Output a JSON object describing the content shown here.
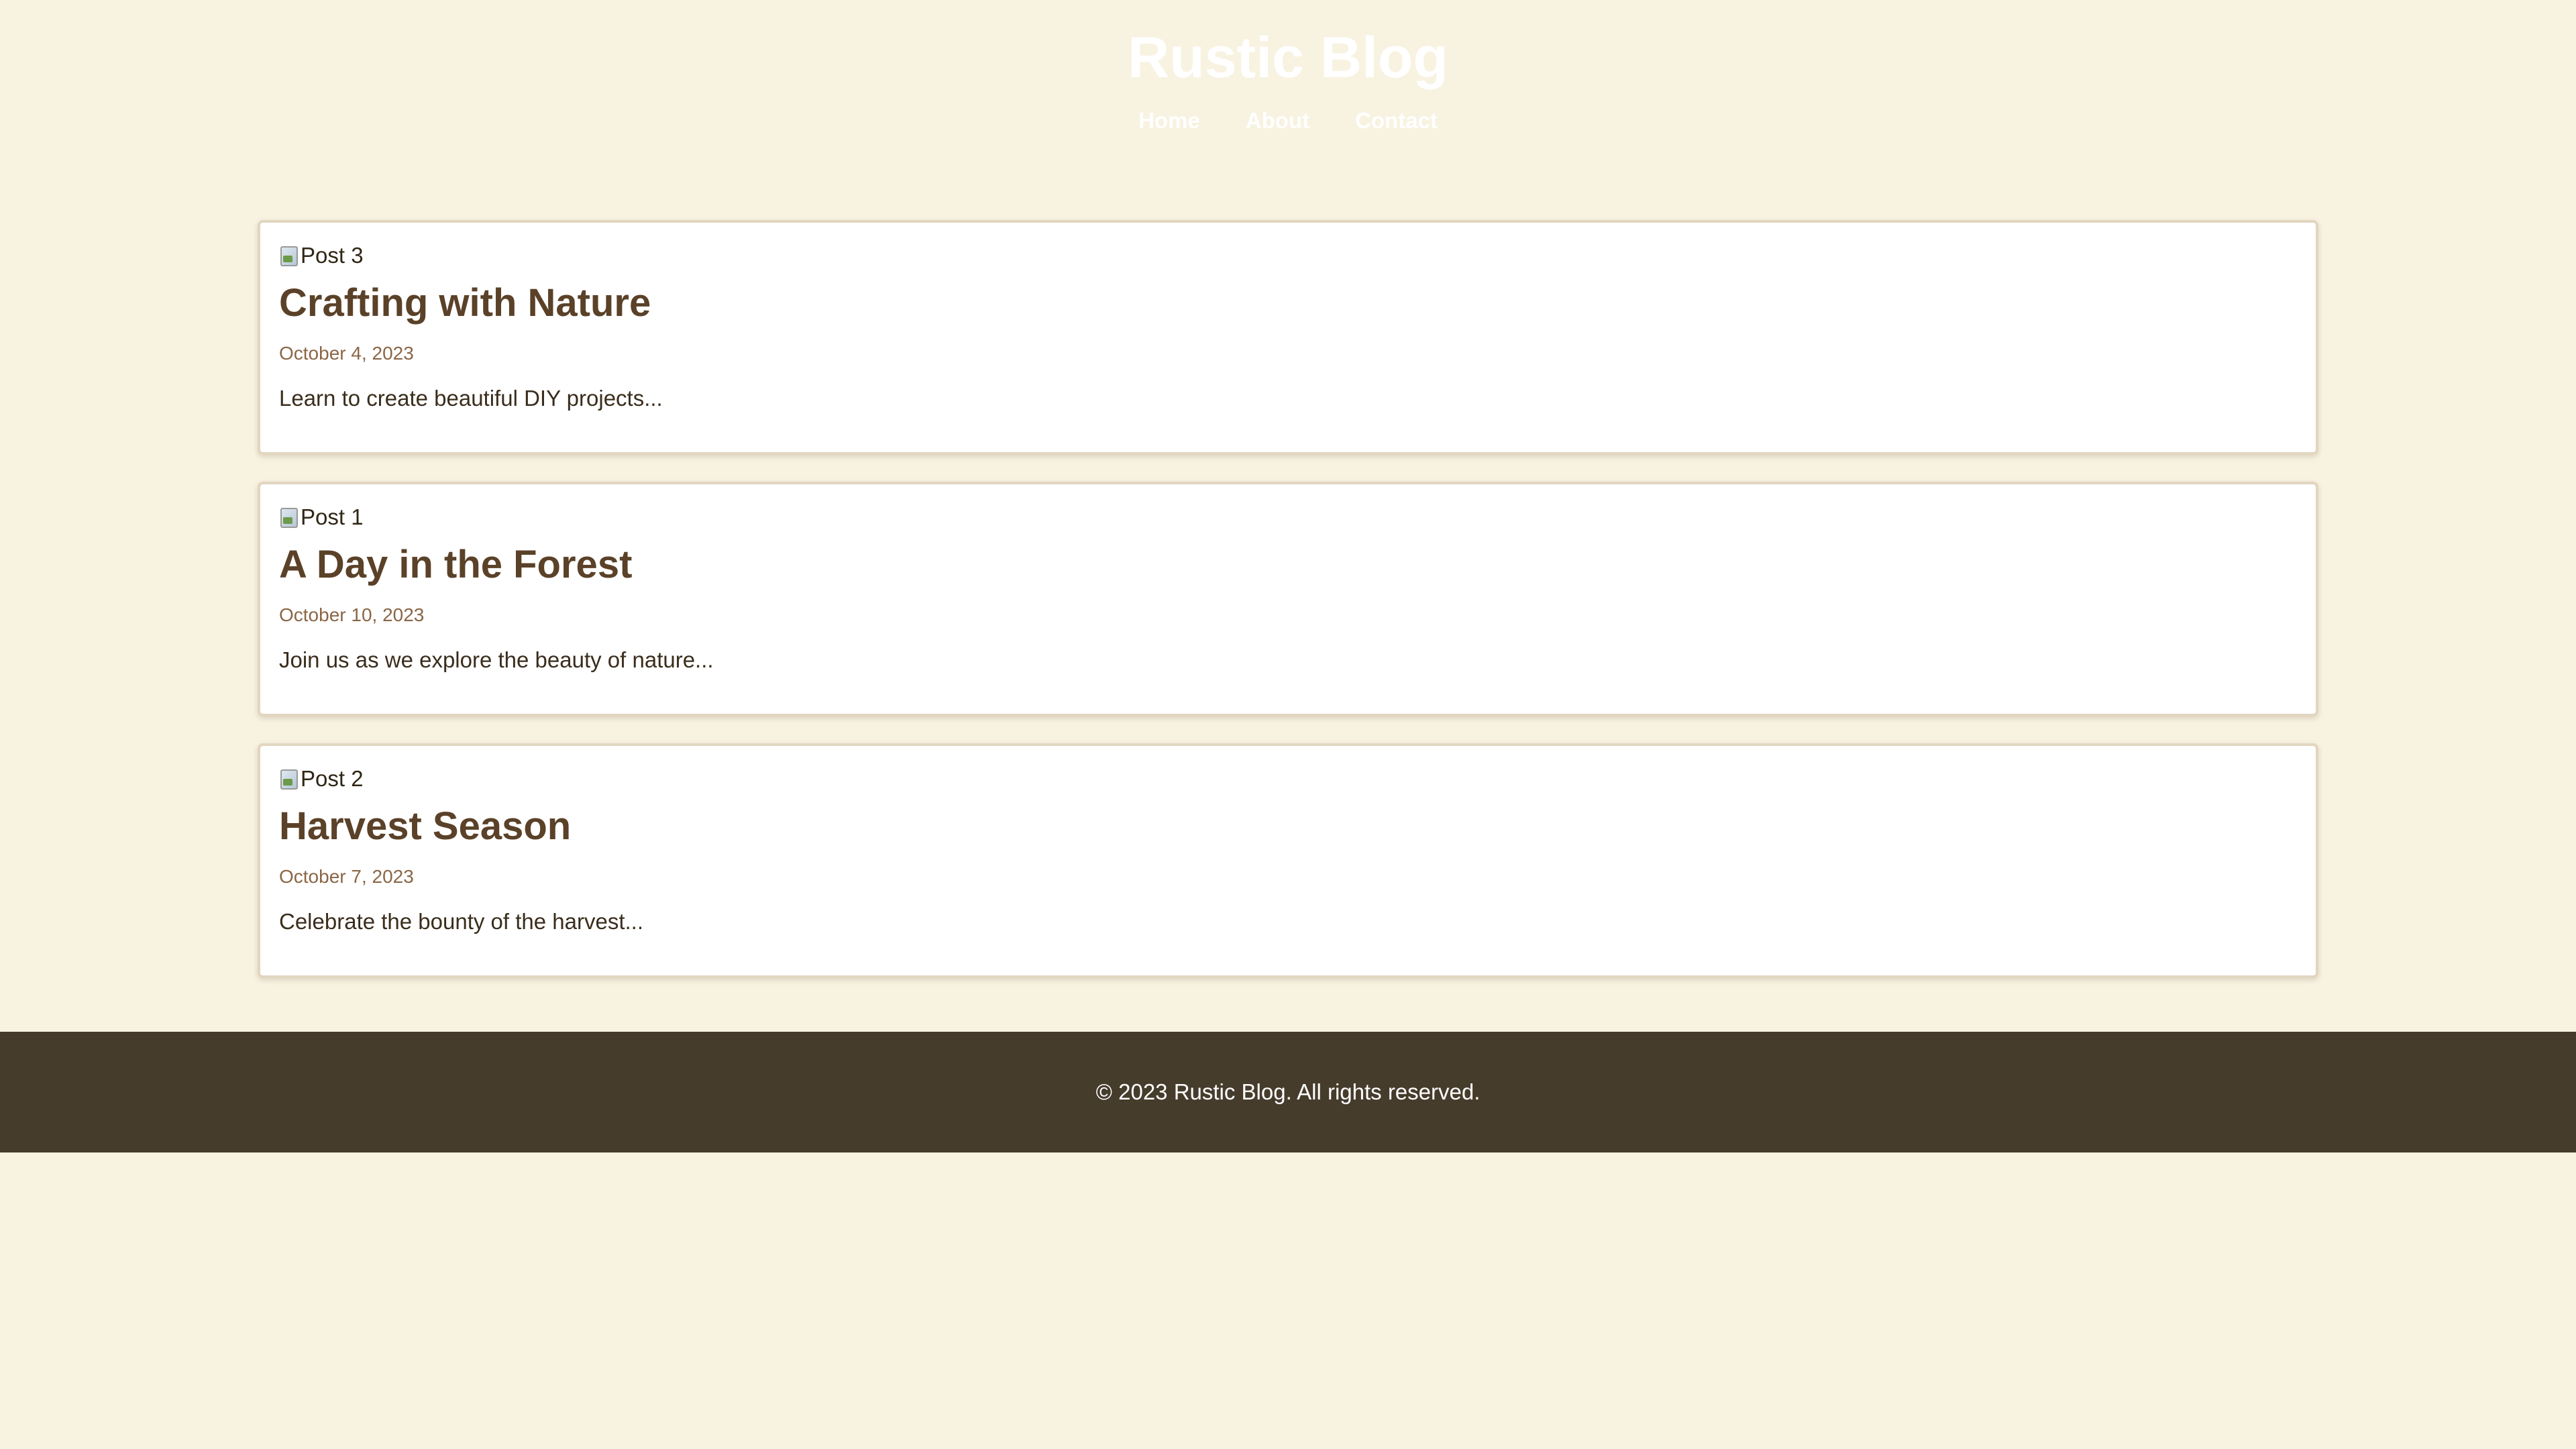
{
  "header": {
    "title": "Rustic Blog",
    "nav": [
      {
        "label": "Home"
      },
      {
        "label": "About"
      },
      {
        "label": "Contact"
      }
    ]
  },
  "posts": [
    {
      "image_alt": "Post 3",
      "title": "Crafting with Nature",
      "date": "October 4, 2023",
      "excerpt": "Learn to create beautiful DIY projects..."
    },
    {
      "image_alt": "Post 1",
      "title": "A Day in the Forest",
      "date": "October 10, 2023",
      "excerpt": "Join us as we explore the beauty of nature..."
    },
    {
      "image_alt": "Post 2",
      "title": "Harvest Season",
      "date": "October 7, 2023",
      "excerpt": "Celebrate the bounty of the harvest..."
    }
  ],
  "footer": {
    "text": "© 2023 Rustic Blog. All rights reserved."
  },
  "colors": {
    "background": "#f8f2e1",
    "title": "#5a4128",
    "date": "#8a6646",
    "footer_bg": "#463c2c"
  }
}
